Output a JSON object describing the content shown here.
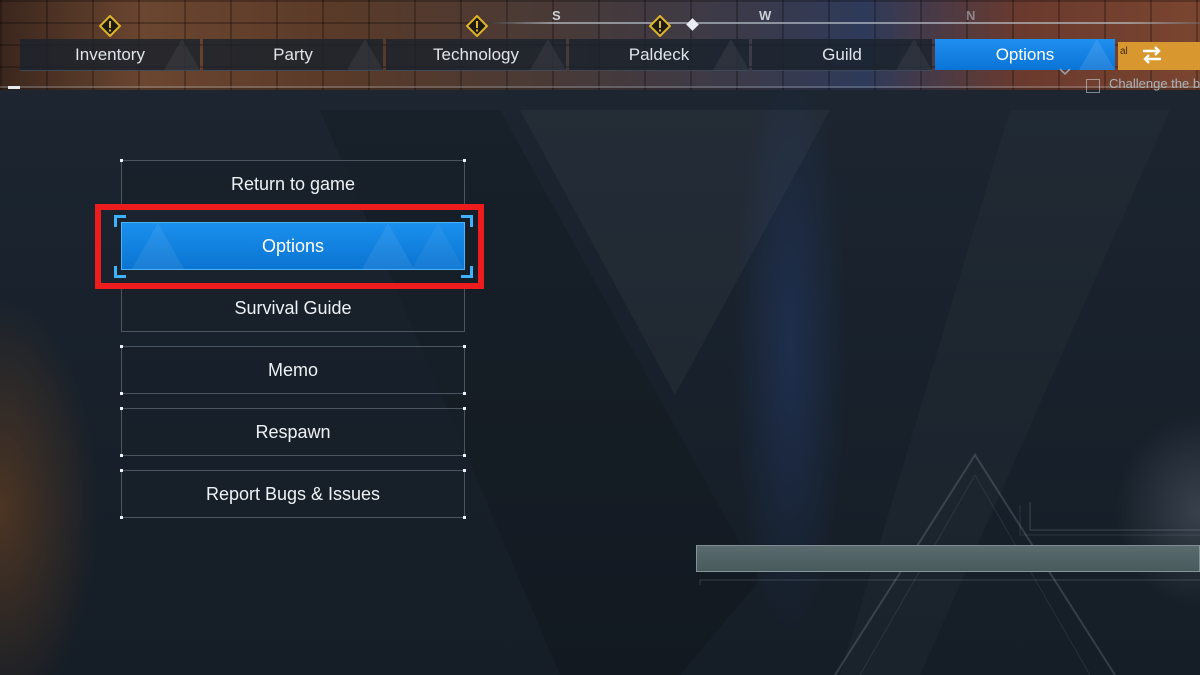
{
  "compass": {
    "letters": [
      "S",
      "W",
      "N"
    ]
  },
  "tabs": [
    {
      "label": "Inventory",
      "active": false
    },
    {
      "label": "Party",
      "active": false
    },
    {
      "label": "Technology",
      "active": false
    },
    {
      "label": "Paldeck",
      "active": false
    },
    {
      "label": "Guild",
      "active": false
    },
    {
      "label": "Options",
      "active": true
    }
  ],
  "header_right": {
    "badge_fragment": "al",
    "quest_text": "Challenge the b"
  },
  "menu": {
    "items": [
      {
        "label": "Return to game"
      },
      {
        "label": "Options",
        "selected": true
      },
      {
        "label": "Survival Guide"
      },
      {
        "label": "Memo"
      },
      {
        "label": "Respawn"
      },
      {
        "label": "Report Bugs & Issues"
      }
    ]
  },
  "colors": {
    "accent_blue": "#0b74d2",
    "highlight_red": "#ee1c1c",
    "warning_yellow": "#e0b52a",
    "badge_orange": "#d9982f"
  },
  "icons": [
    "warning-icon",
    "swap-arrows-icon",
    "chevron-down-icon"
  ]
}
